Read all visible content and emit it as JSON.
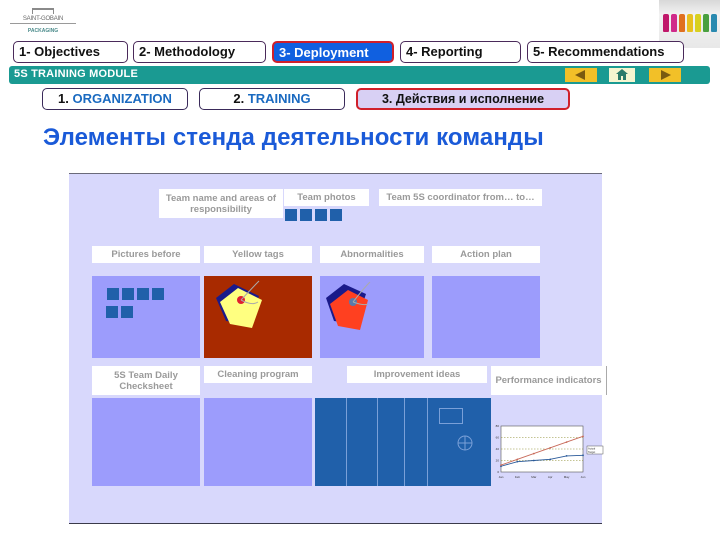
{
  "logo": {
    "name": "SAINT-GOBAIN",
    "sub": "PACKAGING"
  },
  "main_tabs": [
    {
      "label": "1- Objectives",
      "active": false
    },
    {
      "label": "2- Methodology",
      "active": false
    },
    {
      "label": "3- Deployment",
      "active": true
    },
    {
      "label": "4- Reporting",
      "active": false
    },
    {
      "label": "5- Recommendations",
      "active": false
    }
  ],
  "module_bar": {
    "title": "5S TRAINING MODULE",
    "prev_icon": "arrow-left-icon",
    "home_icon": "home-icon",
    "next_icon": "arrow-right-icon"
  },
  "sub_tabs": [
    {
      "num": "1.",
      "label": "ORGANIZATION",
      "active": false
    },
    {
      "num": "2.",
      "label": "TRAINING",
      "active": false
    },
    {
      "num": "3.",
      "label": "Действия и исполнение",
      "active": true
    }
  ],
  "page_title": "Элементы стенда деятельности команды",
  "board": {
    "labels": {
      "team_name": "Team name and areas of responsibility",
      "team_photos": "Team photos",
      "coordinator": "Team 5S coordinator from… to…",
      "pictures_before": "Pictures before",
      "yellow_tags": "Yellow tags",
      "abnormalities": "Abnormalities",
      "action_plan": "Action plan",
      "daily_checksheet": "5S Team Daily Checksheet",
      "cleaning_program": "Cleaning program",
      "improvement_ideas": "Improvement ideas",
      "performance_indicators": "Performance indicators"
    },
    "mini_chart": {
      "type": "line",
      "categories": [
        "Jan",
        "Feb",
        "Mar",
        "Apr",
        "May",
        "Jun"
      ],
      "ylim": [
        0,
        80
      ],
      "series": [
        {
          "name": "Actual",
          "values": [
            10,
            18,
            20,
            22,
            28,
            29
          ],
          "color": "#2a5a9a"
        },
        {
          "name": "Target",
          "values": [
            12,
            22,
            32,
            42,
            52,
            62
          ],
          "color": "#c86a5a"
        }
      ]
    }
  },
  "colors": {
    "accent_blue": "#1a5ad8",
    "module_teal": "#1a9a92",
    "active_tab_border": "#d0202a",
    "board_bg": "#d8d8fc"
  }
}
